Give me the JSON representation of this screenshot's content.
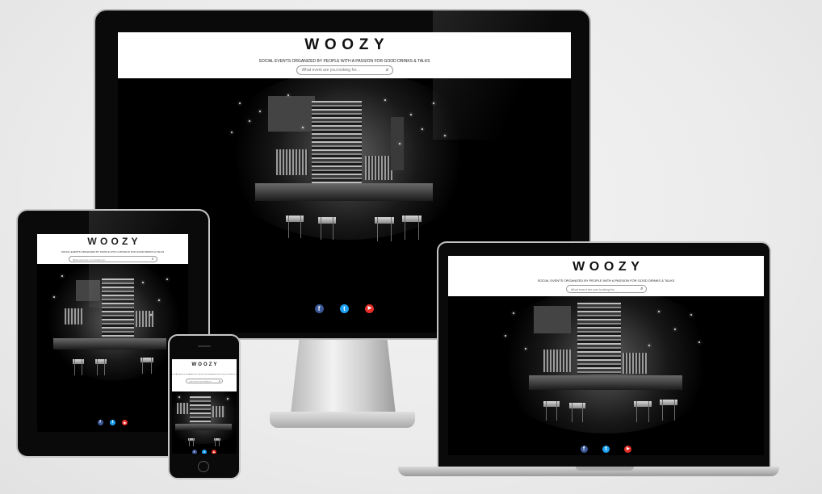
{
  "site": {
    "logo": "WOOZY",
    "tagline": "SOCIAL EVENTS ORGANIZED BY PEOPLE WITH A PASSION FOR GOOD DRINKS & TALKS",
    "search_placeholder": "What event are you looking for...",
    "social": [
      {
        "icon": "facebook-icon",
        "glyph": "f",
        "color": "#3b5998"
      },
      {
        "icon": "twitter-icon",
        "glyph": "t",
        "color": "#1da1f2"
      },
      {
        "icon": "youtube-icon",
        "glyph": "▶",
        "color": "#e52d27"
      }
    ],
    "hero_image": "bar-interior-photo"
  },
  "devices": [
    "desktop-monitor",
    "tablet",
    "laptop",
    "phone"
  ],
  "colors": {
    "background": "#ebebeb",
    "bezel": "#0a0a0a",
    "header": "#ffffff",
    "hero": "#000000"
  }
}
